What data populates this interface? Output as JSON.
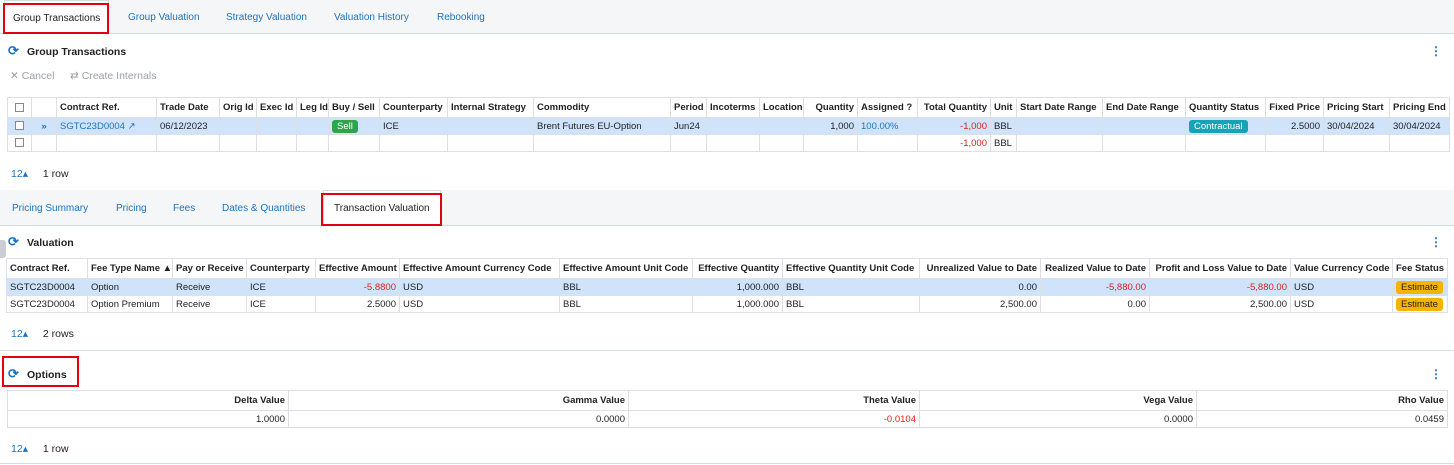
{
  "tabs": [
    "Group Transactions",
    "Group Valuation",
    "Strategy Valuation",
    "Valuation History",
    "Rebooking"
  ],
  "group_panel": {
    "title": "Group Transactions",
    "toolbar": {
      "cancel": "Cancel",
      "create_internals": "Create Internals"
    },
    "headers": [
      "Contract Ref.",
      "Trade Date",
      "Orig Id",
      "Exec Id",
      "Leg Id",
      "Buy / Sell",
      "Counterparty",
      "Internal Strategy",
      "Commodity",
      "Period",
      "Incoterms",
      "Location",
      "Quantity",
      "Assigned ?",
      "Total Quantity",
      "Unit",
      "Start Date Range",
      "End Date Range",
      "Quantity Status",
      "Fixed Price",
      "Pricing Start",
      "Pricing End"
    ],
    "row": {
      "contract_ref": "SGTC23D0004",
      "trade_date": "06/12/2023",
      "buy_sell": "Sell",
      "counterparty": "ICE",
      "commodity": "Brent Futures EU-Option",
      "period": "Jun24",
      "quantity": "1,000",
      "assigned": "100.00%",
      "total_quantity": "-1,000",
      "unit": "BBL",
      "quantity_status": "Contractual",
      "fixed_price": "2.5000",
      "pricing_start": "30/04/2024",
      "pricing_end": "30/04/2024"
    },
    "total": {
      "total_quantity": "-1,000",
      "unit": "BBL"
    },
    "pager": {
      "page_size": "12",
      "count": "1 row"
    }
  },
  "sub_tabs": [
    "Pricing Summary",
    "Pricing",
    "Fees",
    "Dates & Quantities",
    "Transaction Valuation"
  ],
  "valuation_panel": {
    "title": "Valuation",
    "headers": [
      "Contract Ref.",
      "Fee Type Name",
      "Pay or Receive",
      "Counterparty",
      "Effective Amount",
      "Effective Amount Currency Code",
      "Effective Amount Unit Code",
      "Effective Quantity",
      "Effective Quantity Unit Code",
      "Unrealized Value to Date",
      "Realized Value to Date",
      "Profit and Loss Value to Date",
      "Value Currency Code",
      "Fee Status"
    ],
    "rows": [
      [
        "SGTC23D0004",
        "Option",
        "Receive",
        "ICE",
        "-5.8800",
        "USD",
        "BBL",
        "1,000.000",
        "BBL",
        "0.00",
        "-5,880.00",
        "-5,880.00",
        "USD",
        "Estimate"
      ],
      [
        "SGTC23D0004",
        "Option Premium",
        "Receive",
        "ICE",
        "2.5000",
        "USD",
        "BBL",
        "1,000.000",
        "BBL",
        "2,500.00",
        "0.00",
        "2,500.00",
        "USD",
        "Estimate"
      ]
    ],
    "pager": {
      "page_size": "12",
      "count": "2 rows"
    }
  },
  "options_panel": {
    "title": "Options",
    "headers": [
      "Delta Value",
      "Gamma Value",
      "Theta Value",
      "Vega Value",
      "Rho Value"
    ],
    "row": [
      "1.0000",
      "0.0000",
      "-0.0104",
      "0.0000",
      "0.0459"
    ],
    "pager": {
      "page_size": "12",
      "count": "1 row"
    }
  },
  "colors": {
    "accent": "#1e73be",
    "negative": "#e02020",
    "highlight": "#e3000f",
    "selected_row": "#cfe3fb"
  }
}
